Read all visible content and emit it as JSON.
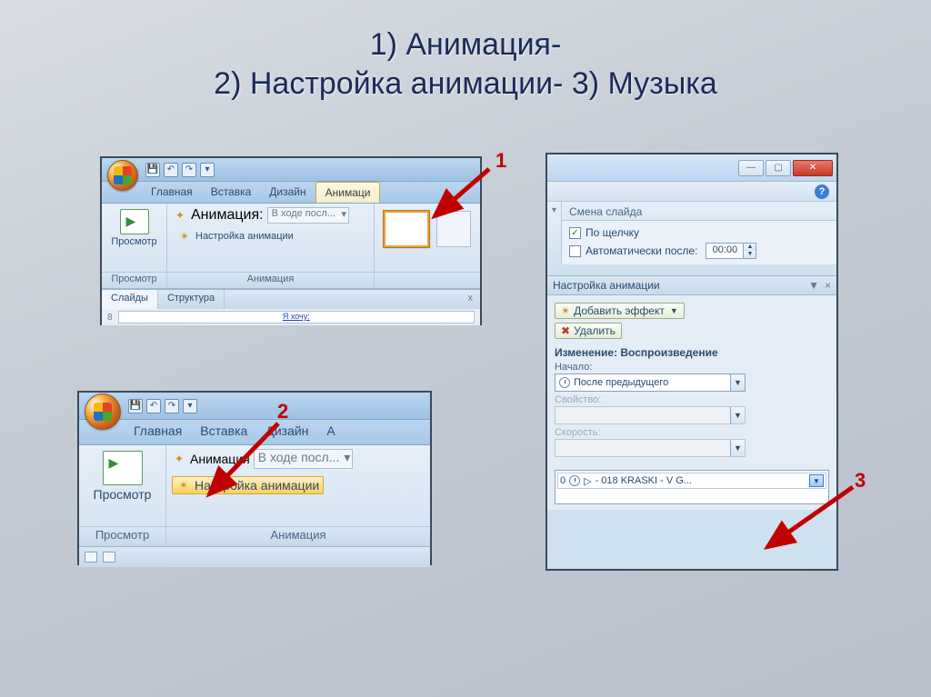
{
  "title_line1": "1) Анимация-",
  "title_line2": "2) Настройка анимации- 3) Музыка",
  "callouts": {
    "n1": "1",
    "n2": "2",
    "n3": "3"
  },
  "p1": {
    "tabs": {
      "home": "Главная",
      "insert": "Вставка",
      "design": "Дизайн",
      "anim": "Анимаци"
    },
    "group_view": "Просмотр",
    "btn_view": "Просмотр",
    "group_anim": "Анимация",
    "row_anim_label": "Анимация:",
    "row_anim_value": "В ходе посл...",
    "cfg_anim": "Настройка анимации",
    "sub_tabs": {
      "slides": "Слайды",
      "structure": "Структура"
    },
    "slide_num": "8",
    "slide_text": "Я хочу:"
  },
  "p2": {
    "tabs": {
      "home": "Главная",
      "insert": "Вставка",
      "design": "Дизайн",
      "anim_initial": "А"
    },
    "group_view": "Просмотр",
    "btn_view": "Просмотр",
    "group_anim": "Анимация",
    "row_anim_label": "Анимация",
    "row_anim_value": "В ходе посл...",
    "cfg_anim": "Настройка анимации"
  },
  "p3": {
    "transition_hdr": "Смена слайда",
    "chk_click": "По щелчку",
    "chk_auto": "Автоматически после:",
    "auto_time": "00:00",
    "pane_title": "Настройка анимации",
    "btn_add": "Добавить эффект",
    "btn_del": "Удалить",
    "change_hdr": "Изменение: Воспроизведение",
    "lbl_start": "Начало:",
    "val_start": "После предыдущего",
    "lbl_prop": "Свойство:",
    "lbl_speed": "Скорость:",
    "item_index": "0",
    "item_text": "- 018 KRASKI - V G..."
  }
}
